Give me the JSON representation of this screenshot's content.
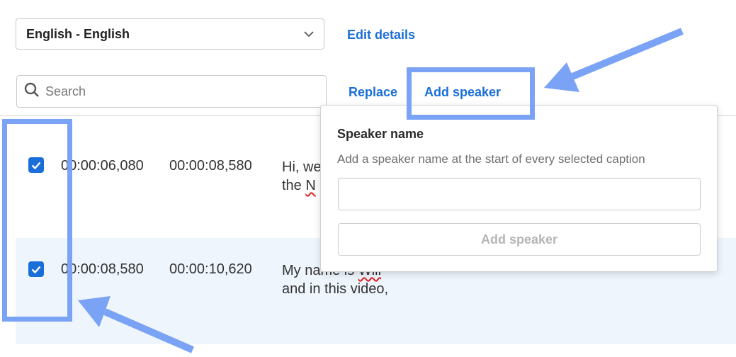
{
  "language_select": {
    "value": "English - English"
  },
  "header_links": {
    "edit_details": "Edit details",
    "replace": "Replace",
    "add_speaker": "Add speaker"
  },
  "search": {
    "placeholder": "Search"
  },
  "captions": [
    {
      "checked": true,
      "start": "00:00:06,080",
      "end": "00:00:08,580",
      "line1": "Hi, we",
      "line2a": "the ",
      "line2b": "N"
    },
    {
      "checked": true,
      "start": "00:00:08,580",
      "end": "00:00:10,620",
      "line1a": "My na",
      "line1b": "me is ",
      "line1c": "Will",
      "line2": "and in this video,"
    }
  ],
  "speaker_popup": {
    "title": "Speaker name",
    "description": "Add a speaker name at the start of every selected caption",
    "input_value": "",
    "button_label": "Add speaker"
  },
  "colors": {
    "accent": "#1a6ed8",
    "highlight": "#7aa3f5",
    "row_selected_bg": "#eef5fd"
  }
}
